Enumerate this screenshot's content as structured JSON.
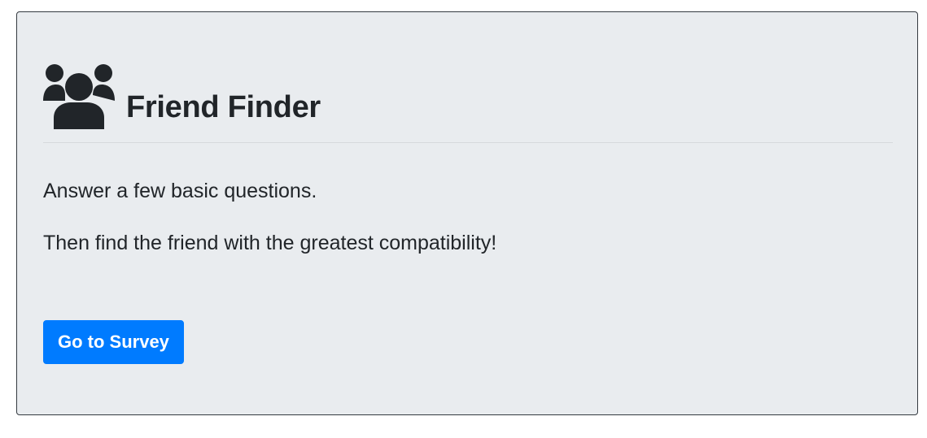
{
  "jumbotron": {
    "title": "Friend Finder",
    "title_icon": "users-icon",
    "lead_lines": [
      "Answer a few basic questions.",
      "Then find the friend with the greatest compatibility!"
    ],
    "cta_button_label": "Go to Survey"
  },
  "colors": {
    "background": "#e9ecef",
    "text": "#212529",
    "button": "#007bff",
    "button_text": "#ffffff",
    "border": "#343a40"
  }
}
